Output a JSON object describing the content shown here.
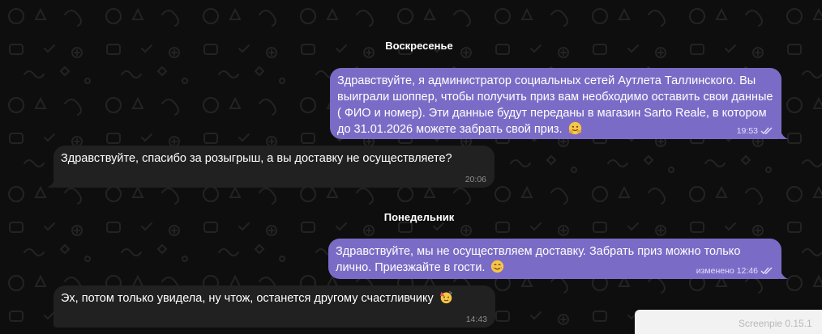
{
  "colors": {
    "background": "#0e0e0e",
    "outgoing_bubble": "#7a6cc6",
    "incoming_bubble": "#212121"
  },
  "chat": {
    "date_separators": [
      "Воскресенье",
      "Понедельник"
    ],
    "messages": [
      {
        "direction": "outgoing",
        "text": "Здравствуйте, я администратор социальных сетей Аутлета Таллинского. Вы выиграли шоппер, чтобы получить приз вам необходимо оставить свои данные ( ФИО и номер). Эти данные будут переданы в магазин Sarto Reale, в котором до 31.01.2026 можете забрать свой приз.",
        "emoji": "hugging-face-emoji",
        "time": "19:53",
        "status": "read"
      },
      {
        "direction": "incoming",
        "text": "Здравствуйте, спасибо за розыгрыш, а вы доставку не осуществляете?",
        "time": "20:06"
      },
      {
        "direction": "outgoing",
        "text": "Здравствуйте, мы не осуществляем доставку. Забрать приз можно только лично. Приезжайте в гости.",
        "emoji": "smiling-face-emoji",
        "edited_label": "изменено",
        "time": "12:46",
        "status": "read"
      },
      {
        "direction": "incoming",
        "text": "Эх, потом только увидела, ну чтож, останется другому счастливчику",
        "emoji": "partying-face-emoji",
        "time": "14:43"
      }
    ]
  },
  "overlay": {
    "text": "Screenpie 0.15.1"
  }
}
